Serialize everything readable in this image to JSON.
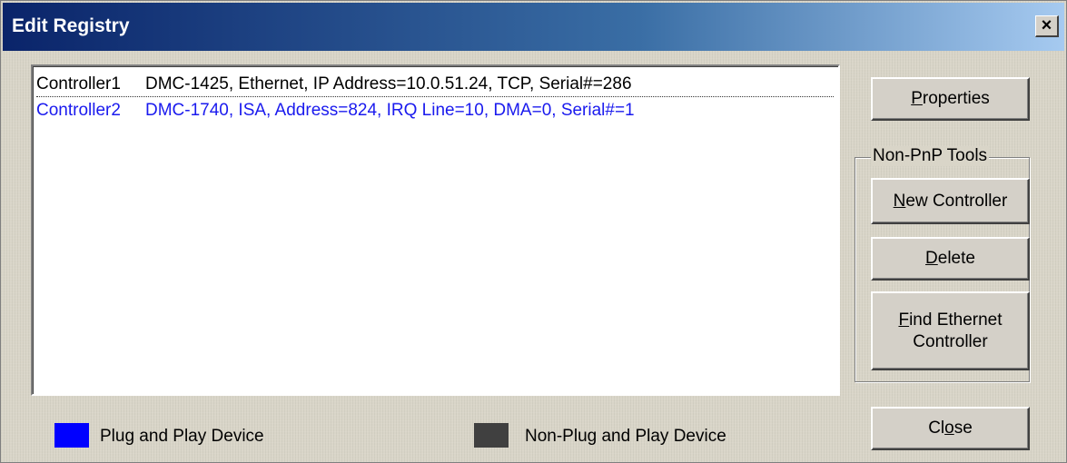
{
  "window": {
    "title": "Edit Registry",
    "close_glyph": "×"
  },
  "list": {
    "rows": [
      {
        "name": "Controller1",
        "detail": "DMC-1425, Ethernet, IP Address=10.0.51.24, TCP, Serial#=286",
        "color": "#000000"
      },
      {
        "name": "Controller2",
        "detail": "DMC-1740, ISA, Address=824, IRQ Line=10, DMA=0, Serial#=1",
        "color": "#1a1aee"
      }
    ]
  },
  "buttons": {
    "properties": {
      "label": "Properties",
      "accel": "P"
    },
    "new_controller": {
      "label": "New Controller",
      "accel": "N"
    },
    "delete": {
      "label": "Delete",
      "accel": "D"
    },
    "find_ethernet_line1": "Find Ethernet",
    "find_ethernet_line2": "Controller",
    "find_ethernet_accel": "F",
    "close": {
      "label": "Close",
      "accel": "o"
    }
  },
  "group": {
    "label": "Non-PnP Tools"
  },
  "legend": {
    "pnp": {
      "label": "Plug and Play Device",
      "color": "#0000ff"
    },
    "non_pnp": {
      "label": "Non-Plug and Play Device",
      "color": "#404040"
    }
  }
}
